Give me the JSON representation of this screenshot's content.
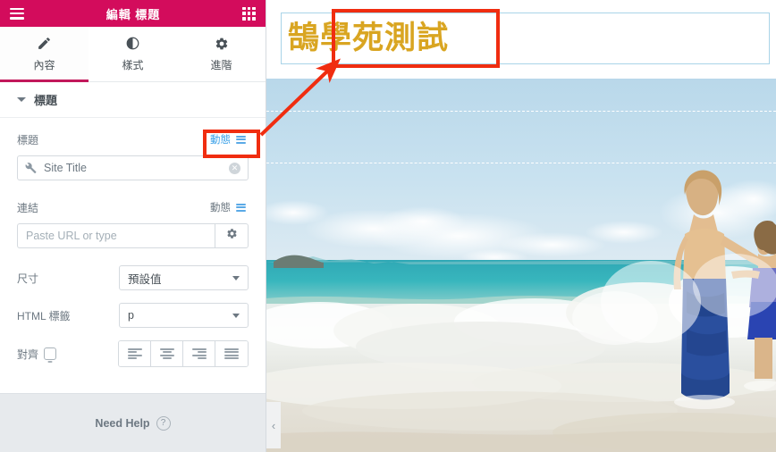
{
  "panel": {
    "header": {
      "title": "編輯 標題",
      "menu_icon": "hamburger-icon",
      "widgets_icon": "grid-apps-icon",
      "bg_color": "#d30c5c"
    },
    "tabs": [
      {
        "label": "內容",
        "icon": "pencil-icon",
        "active": true
      },
      {
        "label": "樣式",
        "icon": "contrast-circle-icon",
        "active": false
      },
      {
        "label": "進階",
        "icon": "gear-icon",
        "active": false
      }
    ],
    "section": {
      "title": "標題",
      "collapse_icon": "caret-down-icon"
    },
    "controls": {
      "title_field": {
        "label": "標題",
        "dynamic_label": "動態",
        "dynamic_icon": "dynamic-tags-icon",
        "dynamic_color": "#3ba1e8",
        "value": "Site Title",
        "prefix_icon": "wrench-icon",
        "clear_icon": "clear-circle-icon",
        "highlighted": true
      },
      "link_field": {
        "label": "連結",
        "dynamic_label": "動態",
        "dynamic_icon": "dynamic-tags-icon",
        "placeholder": "Paste URL or type",
        "settings_icon": "gear-icon"
      },
      "size_field": {
        "label": "尺寸",
        "value": "預設值",
        "arrow_icon": "chevron-down-icon"
      },
      "html_tag_field": {
        "label": "HTML 標籤",
        "value": "p",
        "arrow_icon": "chevron-down-icon"
      },
      "align_field": {
        "label": "對齊",
        "device_icon": "desktop-monitor-icon",
        "options": [
          {
            "name": "align-left",
            "icon": "align-left-icon"
          },
          {
            "name": "align-center",
            "icon": "align-center-icon"
          },
          {
            "name": "align-right",
            "icon": "align-right-icon"
          },
          {
            "name": "align-justify",
            "icon": "align-justify-icon"
          }
        ]
      }
    },
    "footer": {
      "label": "Need Help",
      "icon": "question-circle-icon"
    }
  },
  "preview": {
    "site_title": "鵠學苑測試",
    "site_title_color": "#d9a521",
    "widget_selected": true,
    "selection_border_color": "#a9d4e8",
    "collapse_handle_icon": "chevron-left-icon",
    "hero_alt": "beach-photo-woman-and-child-walking-in-surf"
  },
  "annotation": {
    "highlight_color": "#f02d10",
    "arrow_icon": "red-arrow-icon",
    "boxes": [
      {
        "name": "site-title-callout"
      },
      {
        "name": "dynamic-button-callout"
      }
    ]
  }
}
